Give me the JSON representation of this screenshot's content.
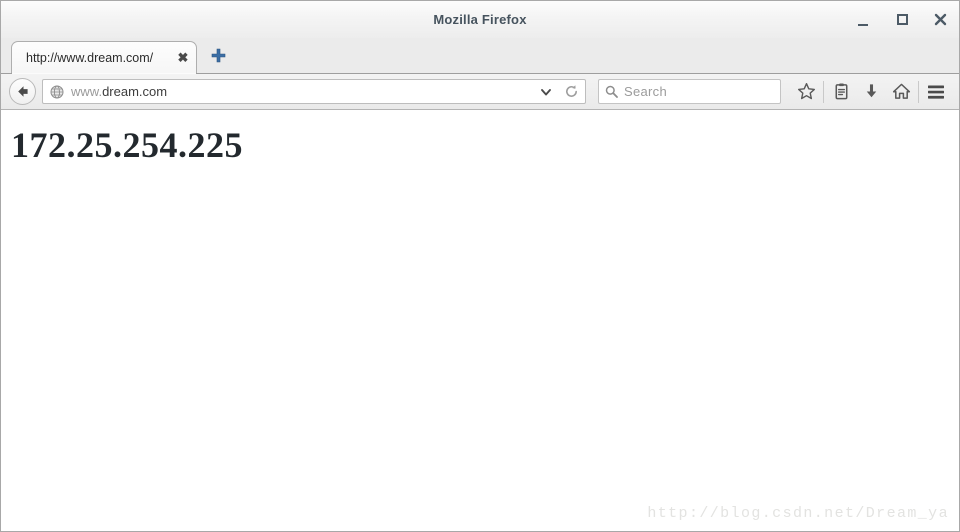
{
  "window": {
    "title": "Mozilla Firefox",
    "controls": [
      {
        "name": "minimize",
        "label": "_"
      },
      {
        "name": "maximize",
        "label": "□"
      },
      {
        "name": "close",
        "label": "✕"
      }
    ]
  },
  "tabstrip": {
    "tabs": [
      {
        "label": "http://www.dream.com/",
        "close_label": "✖",
        "active": true
      }
    ],
    "new_tab_label": "+"
  },
  "navbar": {
    "back_icon": "back-arrow-icon",
    "identity_icon": "globe-icon",
    "url_prefix": "www.",
    "url_domain": "dream.com",
    "url_full": "www.dream.com",
    "dropdown_icon": "chevron-down-icon",
    "reload_icon": "reload-icon",
    "search": {
      "placeholder": "Search",
      "value": "",
      "icon": "search-icon"
    },
    "tool_icons": [
      {
        "name": "bookmark-star-icon",
        "title": "Bookmark this page"
      },
      {
        "name": "reading-list-icon",
        "title": "Reading list"
      },
      {
        "name": "downloads-icon",
        "title": "Downloads"
      },
      {
        "name": "home-icon",
        "title": "Home"
      },
      {
        "name": "menu-hamburger-icon",
        "title": "Open menu"
      }
    ]
  },
  "content": {
    "body_text": "172.25.254.225",
    "watermark": "http://blog.csdn.net/Dream_ya"
  },
  "colors": {
    "titlebar_text": "#46535e",
    "accent_newtab": "#3b6ea5",
    "page_text": "#23292e",
    "watermark": "#e3e3e1"
  }
}
